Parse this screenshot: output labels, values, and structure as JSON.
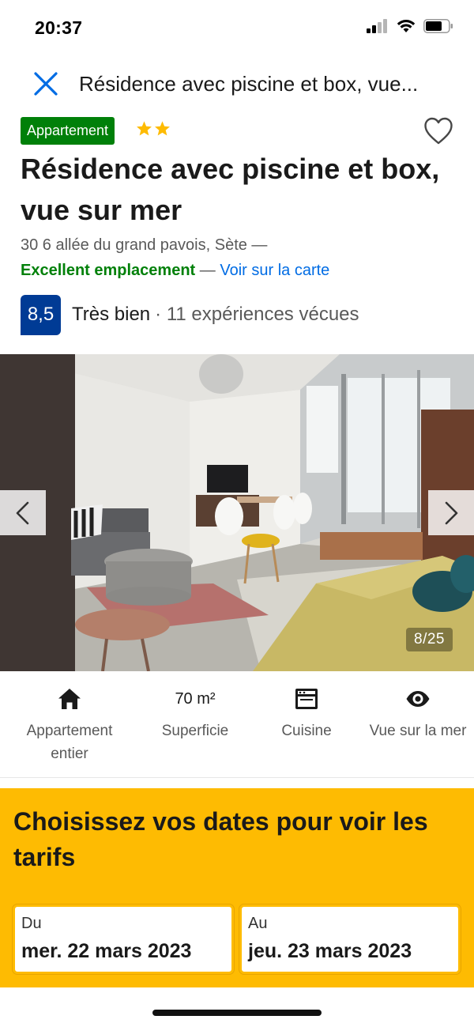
{
  "status_bar": {
    "time": "20:37"
  },
  "header": {
    "title": "Résidence avec piscine et box, vue..."
  },
  "property": {
    "type_badge": "Appartement",
    "star_count": 2,
    "title": "Résidence avec piscine et box, vue sur mer",
    "address": "30 6 allée du grand pavois, Sète —",
    "location_rating": "Excellent emplacement",
    "location_separator": "—",
    "map_link": "Voir sur la carte"
  },
  "review": {
    "score": "8,5",
    "word": "Très bien",
    "count": "· 11 expériences vécues"
  },
  "gallery": {
    "counter": "8/25"
  },
  "facilities": [
    {
      "icon": "house-icon",
      "value": "",
      "label": "Appartement entier"
    },
    {
      "icon": "",
      "value": "70 m²",
      "label": "Superficie"
    },
    {
      "icon": "kitchen-icon",
      "value": "",
      "label": "Cuisine"
    },
    {
      "icon": "eye-icon",
      "value": "",
      "label": "Vue sur la mer"
    }
  ],
  "dates": {
    "title": "Choisissez vos dates pour voir les tarifs",
    "from_label": "Du",
    "from_value": "mer. 22 mars 2023",
    "to_label": "Au",
    "to_value": "jeu. 23 mars 2023"
  },
  "colors": {
    "badge_green": "#008009",
    "star_yellow": "#febb02",
    "score_blue": "#003b95",
    "link_blue": "#006ce4",
    "dates_panel": "#febb02"
  }
}
